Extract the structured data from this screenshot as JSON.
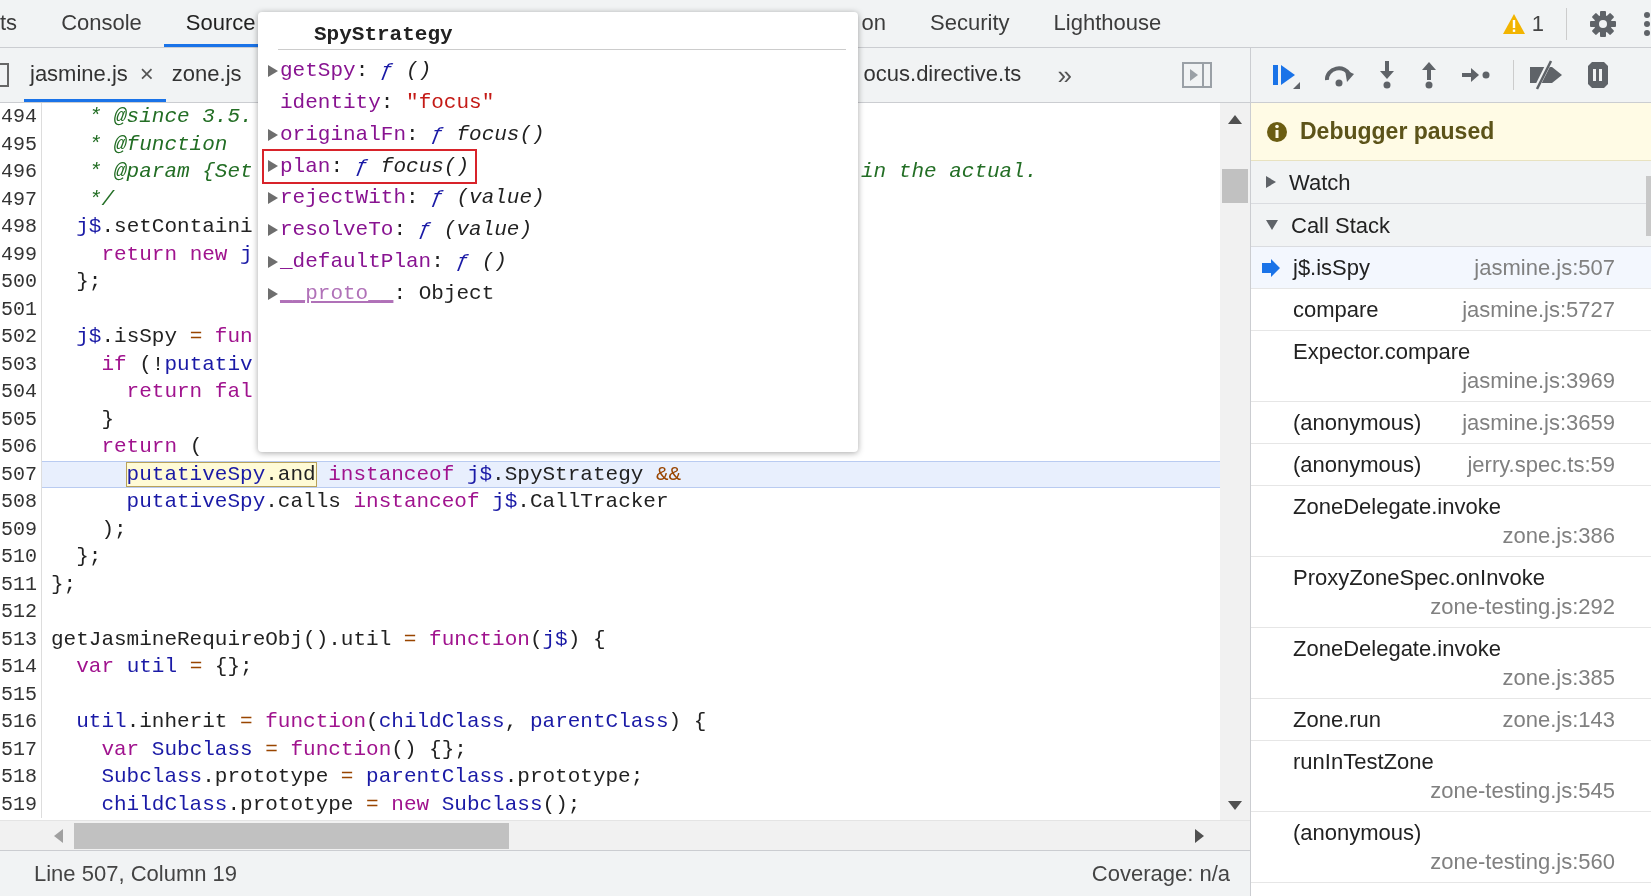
{
  "main_tabs": [
    {
      "label": "ts",
      "selected": false
    },
    {
      "label": "Console",
      "selected": false
    },
    {
      "label": "Source",
      "selected": true
    },
    {
      "label": "on",
      "selected": false
    },
    {
      "label": "Security",
      "selected": false
    },
    {
      "label": "Lighthouse",
      "selected": false
    }
  ],
  "issues": {
    "count": "1"
  },
  "file_tabs": [
    {
      "label": "jasmine.js",
      "selected": true,
      "close": "×"
    },
    {
      "label": "zone.js",
      "selected": false
    },
    {
      "label": "ocus.directive.ts",
      "selected": false
    }
  ],
  "more_tabs": "»",
  "code": {
    "lines": [
      {
        "number": "494",
        "current": false,
        "tokens": [
          {
            "kind": "comment",
            "text": "   * @since 3.5."
          }
        ]
      },
      {
        "number": "495",
        "current": false,
        "tokens": [
          {
            "kind": "comment",
            "text": "   * @function"
          }
        ]
      },
      {
        "number": "496",
        "current": false,
        "tokens": [
          {
            "kind": "comment",
            "text": "   * @param {Set"
          }
        ],
        "tail": [
          {
            "kind": "comment",
            "text": "in the actual."
          }
        ]
      },
      {
        "number": "497",
        "current": false,
        "tokens": [
          {
            "kind": "comment",
            "text": "   */"
          }
        ]
      },
      {
        "number": "498",
        "current": false,
        "tokens": [
          {
            "kind": "ident",
            "text": "  j$"
          },
          {
            "kind": "plain",
            "text": ".setContaini"
          }
        ]
      },
      {
        "number": "499",
        "current": false,
        "tokens": [
          {
            "kind": "kw",
            "text": "    return "
          },
          {
            "kind": "kw",
            "text": "new "
          },
          {
            "kind": "ident",
            "text": "j"
          }
        ]
      },
      {
        "number": "500",
        "current": false,
        "tokens": [
          {
            "kind": "plain",
            "text": "  };"
          }
        ]
      },
      {
        "number": "501",
        "current": false
      },
      {
        "number": "502",
        "current": false,
        "tokens": [
          {
            "kind": "ident",
            "text": "  j$"
          },
          {
            "kind": "plain",
            "text": ".isSpy "
          },
          {
            "kind": "op",
            "text": "= "
          },
          {
            "kind": "kw",
            "text": "fun"
          }
        ]
      },
      {
        "number": "503",
        "current": false,
        "tokens": [
          {
            "kind": "kw",
            "text": "    if"
          },
          {
            "kind": "plain",
            "text": " (!"
          },
          {
            "kind": "ident",
            "text": "putativ"
          }
        ]
      },
      {
        "number": "504",
        "current": false,
        "tokens": [
          {
            "kind": "kw",
            "text": "      return "
          },
          {
            "kind": "kw",
            "text": "fal"
          }
        ]
      },
      {
        "number": "505",
        "current": false,
        "tokens": [
          {
            "kind": "plain",
            "text": "    }"
          }
        ]
      },
      {
        "number": "506",
        "current": false,
        "tokens": [
          {
            "kind": "kw",
            "text": "    return"
          },
          {
            "kind": "plain",
            "text": " ("
          }
        ]
      },
      {
        "number": "507",
        "current": true,
        "tokens": [
          {
            "kind": "hover",
            "parts": [
              {
                "kind": "ident",
                "text": "putativeSpy"
              },
              {
                "kind": "plain",
                "text": ".and"
              }
            ]
          },
          {
            "kind": "kw",
            "text": " instanceof "
          },
          {
            "kind": "ident",
            "text": "j$"
          },
          {
            "kind": "plain",
            "text": ".SpyStrategy "
          },
          {
            "kind": "op",
            "text": "&&"
          }
        ]
      },
      {
        "number": "508",
        "current": false,
        "tokens": [
          {
            "kind": "ident",
            "text": "      putativeSpy"
          },
          {
            "kind": "plain",
            "text": ".calls "
          },
          {
            "kind": "kw",
            "text": "instanceof "
          },
          {
            "kind": "ident",
            "text": "j$"
          },
          {
            "kind": "plain",
            "text": ".CallTracker"
          }
        ]
      },
      {
        "number": "509",
        "current": false,
        "tokens": [
          {
            "kind": "plain",
            "text": "    );"
          }
        ]
      },
      {
        "number": "510",
        "current": false,
        "tokens": [
          {
            "kind": "plain",
            "text": "  };"
          }
        ]
      },
      {
        "number": "511",
        "current": false,
        "tokens": [
          {
            "kind": "plain",
            "text": "};"
          }
        ]
      },
      {
        "number": "512",
        "current": false
      },
      {
        "number": "513",
        "current": false,
        "tokens": [
          {
            "kind": "plain",
            "text": "getJasmineRequireObj().util "
          },
          {
            "kind": "op",
            "text": "= "
          },
          {
            "kind": "kw",
            "text": "function"
          },
          {
            "kind": "plain",
            "text": "("
          },
          {
            "kind": "ident",
            "text": "j$"
          },
          {
            "kind": "plain",
            "text": ") {"
          }
        ]
      },
      {
        "number": "514",
        "current": false,
        "tokens": [
          {
            "kind": "kw",
            "text": "  var "
          },
          {
            "kind": "ident",
            "text": "util "
          },
          {
            "kind": "op",
            "text": "="
          },
          {
            "kind": "plain",
            "text": " {};"
          }
        ]
      },
      {
        "number": "515",
        "current": false
      },
      {
        "number": "516",
        "current": false,
        "tokens": [
          {
            "kind": "ident",
            "text": "  util"
          },
          {
            "kind": "plain",
            "text": ".inherit "
          },
          {
            "kind": "op",
            "text": "= "
          },
          {
            "kind": "kw",
            "text": "function"
          },
          {
            "kind": "plain",
            "text": "("
          },
          {
            "kind": "ident",
            "text": "childClass"
          },
          {
            "kind": "plain",
            "text": ", "
          },
          {
            "kind": "ident",
            "text": "parentClass"
          },
          {
            "kind": "plain",
            "text": ") {"
          }
        ]
      },
      {
        "number": "517",
        "current": false,
        "tokens": [
          {
            "kind": "kw",
            "text": "    var "
          },
          {
            "kind": "ident",
            "text": "Subclass "
          },
          {
            "kind": "op",
            "text": "= "
          },
          {
            "kind": "kw",
            "text": "function"
          },
          {
            "kind": "plain",
            "text": "() {};"
          }
        ]
      },
      {
        "number": "518",
        "current": false,
        "tokens": [
          {
            "kind": "ident",
            "text": "    Subclass"
          },
          {
            "kind": "plain",
            "text": ".prototype "
          },
          {
            "kind": "op",
            "text": "= "
          },
          {
            "kind": "ident",
            "text": "parentClass"
          },
          {
            "kind": "plain",
            "text": ".prototype;"
          }
        ]
      },
      {
        "number": "519",
        "current": false,
        "tokens": [
          {
            "kind": "ident",
            "text": "    childClass"
          },
          {
            "kind": "plain",
            "text": ".prototype "
          },
          {
            "kind": "op",
            "text": "= "
          },
          {
            "kind": "kw",
            "text": "new "
          },
          {
            "kind": "ident",
            "text": "Subclass"
          },
          {
            "kind": "plain",
            "text": "();"
          }
        ]
      }
    ]
  },
  "popup": {
    "title": "SpyStrategy",
    "properties": [
      {
        "name": "getSpy",
        "separator": ":",
        "kind": "function",
        "marker": "ƒ",
        "value": "()",
        "expandable": true,
        "outlined": false,
        "dimmed": false
      },
      {
        "name": "identity",
        "separator": ":",
        "kind": "string",
        "value": "\"focus\"",
        "expandable": false,
        "outlined": false,
        "dimmed": false
      },
      {
        "name": "originalFn",
        "separator": ":",
        "kind": "function",
        "marker": "ƒ",
        "value": "focus()",
        "expandable": true,
        "outlined": false,
        "dimmed": false
      },
      {
        "name": "plan",
        "separator": ":",
        "kind": "function",
        "marker": "ƒ",
        "value": "focus()",
        "expandable": true,
        "outlined": true,
        "dimmed": false
      },
      {
        "name": "rejectWith",
        "separator": ":",
        "kind": "function",
        "marker": "ƒ",
        "value": "(value)",
        "expandable": true,
        "outlined": false,
        "dimmed": false
      },
      {
        "name": "resolveTo",
        "separator": ":",
        "kind": "function",
        "marker": "ƒ",
        "value": "(value)",
        "expandable": true,
        "outlined": false,
        "dimmed": false
      },
      {
        "name": "_defaultPlan",
        "separator": ":",
        "kind": "function",
        "marker": "ƒ",
        "value": "()",
        "expandable": true,
        "outlined": false,
        "dimmed": false
      },
      {
        "name": "__proto__",
        "separator": ":",
        "kind": "object",
        "value": "Object",
        "expandable": true,
        "outlined": false,
        "dimmed": true
      }
    ]
  },
  "paused_banner": "Debugger paused",
  "sections": [
    {
      "title": "Watch",
      "expanded": false
    },
    {
      "title": "Call Stack",
      "expanded": true,
      "frames": [
        {
          "name": "j$.isSpy",
          "location": "jasmine.js:507",
          "selected": true
        },
        {
          "name": "compare",
          "location": "jasmine.js:5727",
          "selected": false
        },
        {
          "name": "Expector.compare",
          "location": "jasmine.js:3969",
          "selected": false
        },
        {
          "name": "(anonymous)",
          "location": "jasmine.js:3659",
          "selected": false
        },
        {
          "name": "(anonymous)",
          "location": "jerry.spec.ts:59",
          "selected": false
        },
        {
          "name": "ZoneDelegate.invoke",
          "location": "zone.js:386",
          "selected": false
        },
        {
          "name": "ProxyZoneSpec.onInvoke",
          "location": "zone-testing.js:292",
          "selected": false
        },
        {
          "name": "ZoneDelegate.invoke",
          "location": "zone.js:385",
          "selected": false
        },
        {
          "name": "Zone.run",
          "location": "zone.js:143",
          "selected": false
        },
        {
          "name": "runInTestZone",
          "location": "zone-testing.js:545",
          "selected": false
        },
        {
          "name": "(anonymous)",
          "location": "zone-testing.js:560",
          "selected": false
        }
      ]
    }
  ],
  "status_bar": {
    "position": "Line 507, Column 19",
    "coverage": "Coverage: n/a"
  }
}
